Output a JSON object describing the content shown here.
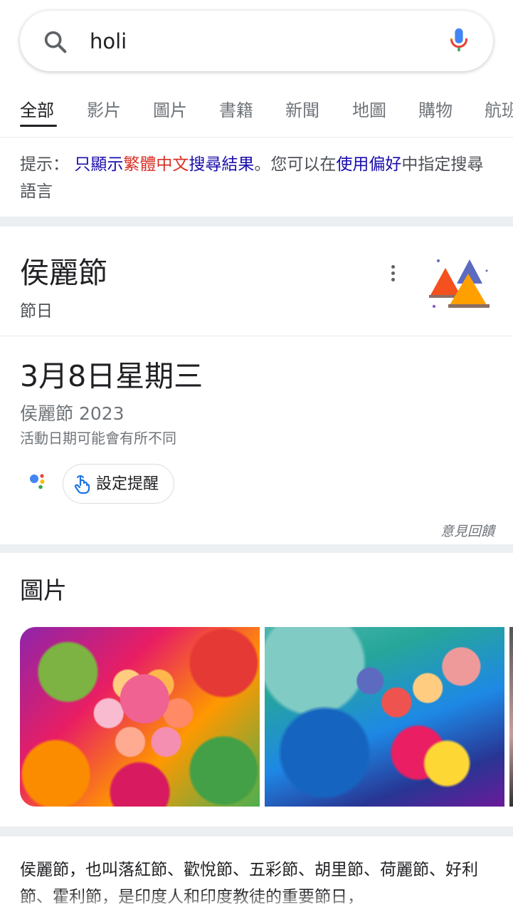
{
  "search": {
    "query": "holi"
  },
  "tabs": [
    {
      "label": "全部",
      "active": true
    },
    {
      "label": "影片"
    },
    {
      "label": "圖片"
    },
    {
      "label": "書籍"
    },
    {
      "label": "新聞"
    },
    {
      "label": "地圖"
    },
    {
      "label": "購物"
    },
    {
      "label": "航班"
    }
  ],
  "hint": {
    "prefix": "提示：",
    "link1_part1": "只顯示",
    "link1_red": "繁體中文",
    "link1_part2": "搜尋結果",
    "middle": "。您可以在",
    "link2": "使用偏好",
    "suffix": "中指定搜尋語言"
  },
  "knowledge": {
    "title": "侯麗節",
    "subtitle": "節日",
    "date": "3月8日星期三",
    "event_year": "侯麗節 2023",
    "note": "活動日期可能會有所不同",
    "reminder_label": "設定提醒",
    "feedback": "意見回饋"
  },
  "images": {
    "title": "圖片"
  },
  "description": "侯麗節，也叫落紅節、歡悅節、五彩節、胡里節、荷麗節、好利節、霍利節，是印度人和印度教徒的重要節日，",
  "colors": {
    "link": "#1a0dab",
    "highlight_red": "#d93025",
    "google_blue": "#4285f4",
    "google_red": "#ea4335",
    "google_yellow": "#fbbc05",
    "google_green": "#34a853"
  }
}
